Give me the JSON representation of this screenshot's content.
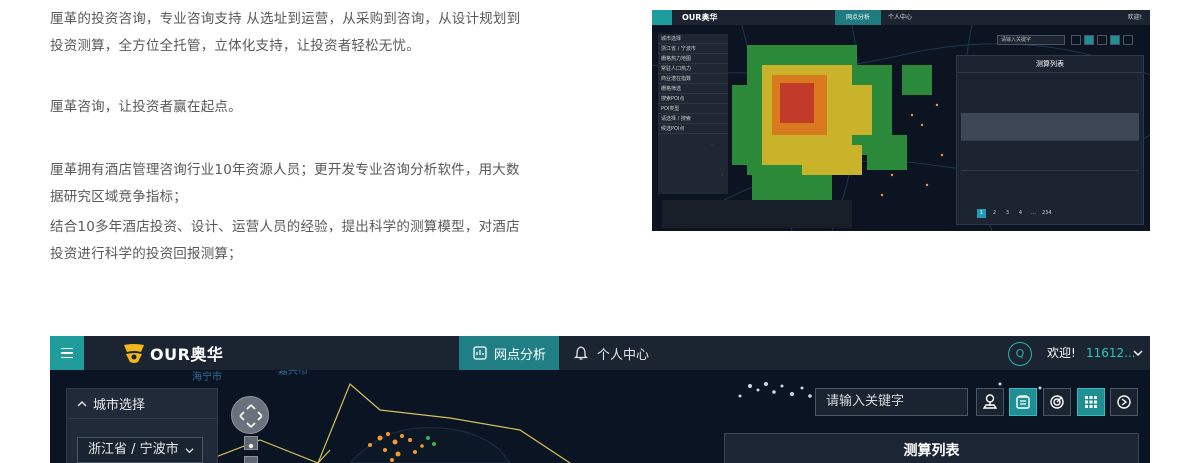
{
  "intro": {
    "p1": "厘革的投资咨询，专业咨询支持 从选址到运营，从采购到咨询，从设计规划到投资测算，全方位全托管，立体化支持，让投资者轻松无忧。",
    "p2": "厘革咨询，让投资者赢在起点。",
    "p3": "厘革拥有酒店管理咨询行业10年资源人员；更开发专业咨询分析软件，用大数据研究区域竞争指标；",
    "p4": "结合10多年酒店投资、设计、运营人员的经验，提出科学的测算模型，对酒店投资进行科学的投资回报测算；"
  },
  "thumb": {
    "logo": "OUR奥华",
    "tab_active": "网点分析",
    "tab_other": "个人中心",
    "welcome": "欢迎!",
    "search_placeholder": "请输入关键字",
    "panel_title": "测算列表",
    "sidebar": [
      "城市选择",
      "浙江省 / 宁波市",
      "栅格热力地图",
      "常驻人口热力",
      "商业潜在指数",
      "栅格筛选",
      "搜索POI点",
      "POI类型",
      "请选择 / 搜索",
      "候选POI点"
    ],
    "pages": [
      "1",
      "2",
      "3",
      "4",
      "…",
      "234"
    ]
  },
  "app": {
    "logo_text": "OUR奥华",
    "tab_active": "网点分析",
    "tab_personal": "个人中心",
    "welcome": "欢迎!",
    "user": "11612...",
    "city_panel_title": "城市选择",
    "city_value": "浙江省 / 宁波市",
    "search_placeholder": "请输入关键字",
    "calc_panel_title": "测算列表",
    "map_labels": [
      "海宁市",
      "嘉兴市"
    ],
    "icons": {
      "menu": "menu-icon",
      "tab_active": "grid-chart-icon",
      "tab_personal": "bell-icon",
      "user_avatar": "q-avatar-icon",
      "tools": [
        "location-pin-icon",
        "list-panel-icon",
        "radar-target-icon",
        "grid-apps-icon",
        "reset-icon"
      ]
    },
    "colors": {
      "accent": "#1f9c9c",
      "topbar": "#1b2431",
      "map_bg": "#0a1422",
      "user_text": "#2fc4c6"
    }
  }
}
